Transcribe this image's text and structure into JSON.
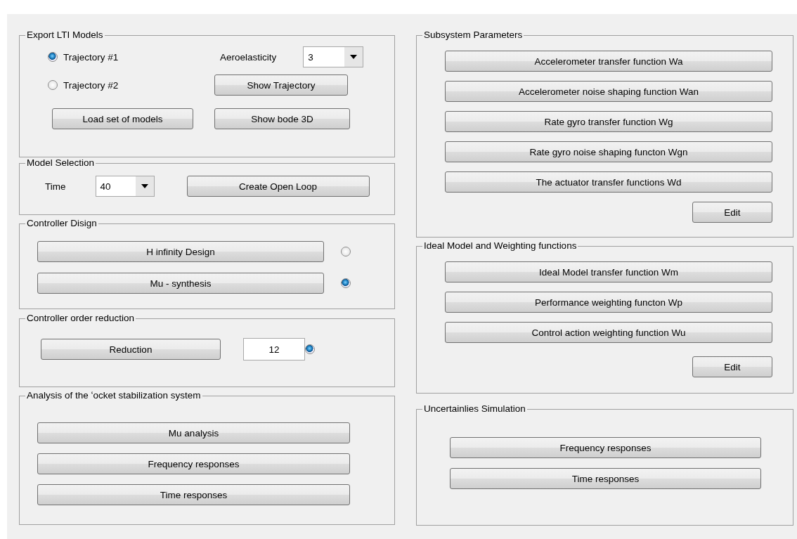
{
  "export_lti_models": {
    "title": "Export LTI Models",
    "trajectories": [
      {
        "label": "Trajectory #1",
        "selected": true
      },
      {
        "label": "Trajectory #2",
        "selected": false
      }
    ],
    "aeroelasticity": {
      "label": "Aeroelasticity",
      "value": "3"
    },
    "buttons": [
      "Show Trajectory",
      "Load set of models",
      "Show bode 3D"
    ]
  },
  "model_selection": {
    "title": "Model Selection",
    "time": {
      "label": "Time",
      "value": "40"
    },
    "button": "Create Open Loop"
  },
  "controller_design": {
    "title": "Controller Disign",
    "options": [
      {
        "label": "H infinity Design",
        "selected": false
      },
      {
        "label": "Mu - synthesis",
        "selected": true
      }
    ]
  },
  "controller_order_reduction": {
    "title": "Controller order reduction",
    "button": "Reduction",
    "order": "12",
    "selected": true
  },
  "analysis": {
    "title": "Analysis of the ʻocket stabilization system",
    "buttons": [
      "Mu analysis",
      "Frequency responses",
      "Time responses"
    ]
  },
  "subsystem_parameters": {
    "title": "Subsystem Parameters",
    "buttons": [
      "Accelerometer transfer function Wa",
      "Accelerometer noise shaping function Wan",
      "Rate gyro transfer function Wg",
      "Rate gyro noise shaping functon Wgn",
      "The actuator transfer functions Wd"
    ],
    "edit": "Edit"
  },
  "ideal_model_weighting": {
    "title": "Ideal Model and Weighting functions",
    "buttons": [
      "Ideal Model transfer function Wm",
      "Performance weighting functon Wp",
      "Control action weighting function Wu"
    ],
    "edit": "Edit"
  },
  "uncertainties_simulation": {
    "title": "Uncertainlies Simulation",
    "buttons": [
      "Frequency responses",
      "Time responses"
    ]
  }
}
